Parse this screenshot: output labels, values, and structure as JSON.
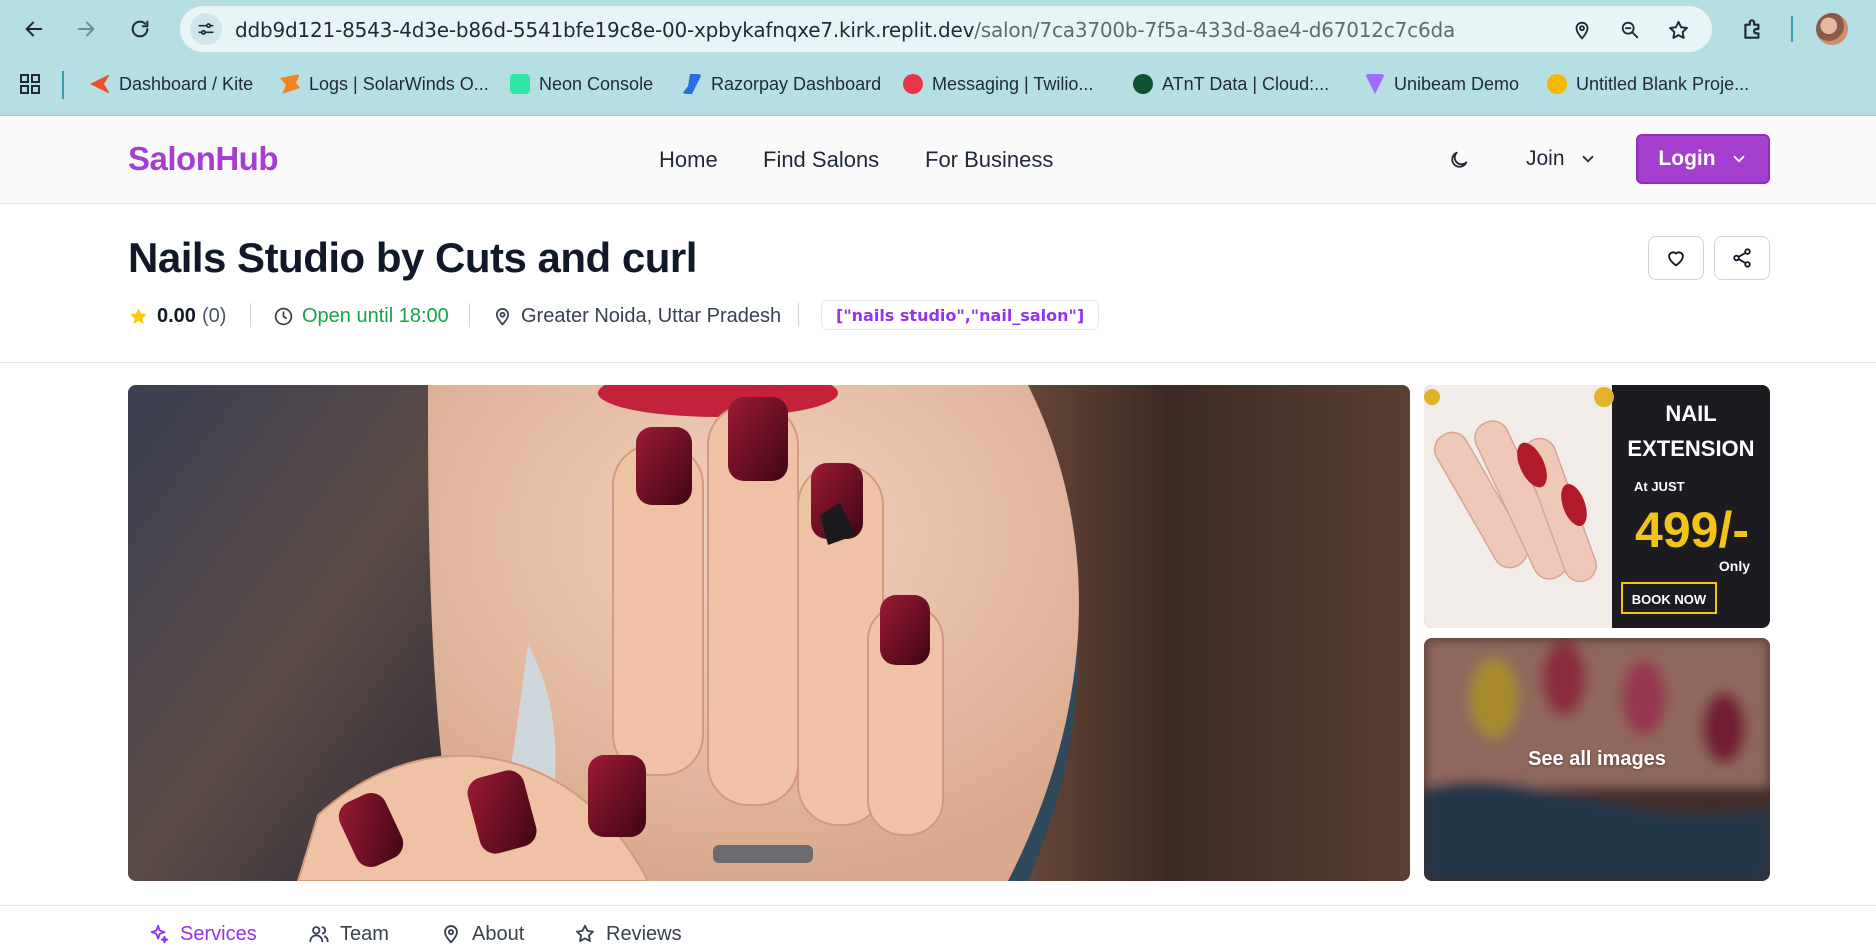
{
  "browser": {
    "url_host": "ddb9d121-8543-4d3e-b86d-5541bfe19c8e-00-xpbykafnqxe7.kirk.replit.dev",
    "url_path": "/salon/7ca3700b-7f5a-433d-8ae4-d67012c7c6da",
    "bookmarks": [
      {
        "label": "Dashboard / Kite",
        "icon": "kite-icon",
        "color": "#e9512b"
      },
      {
        "label": "Logs | SolarWinds O...",
        "icon": "solarwinds-icon",
        "color": "#f58220"
      },
      {
        "label": "Neon Console",
        "icon": "neon-icon",
        "color": "#2ee6a6"
      },
      {
        "label": "Razorpay Dashboard",
        "icon": "razorpay-icon",
        "color": "#2b6de8"
      },
      {
        "label": "Messaging | Twilio...",
        "icon": "twilio-icon",
        "color": "#e8354b"
      },
      {
        "label": "ATnT Data | Cloud:...",
        "icon": "mongodb-icon",
        "color": "#0f5132"
      },
      {
        "label": "Unibeam Demo",
        "icon": "vite-icon",
        "color": "#9c6cff"
      },
      {
        "label": "Untitled Blank Proje...",
        "icon": "bookmark-favicon-yellow",
        "color": "#f5b800"
      }
    ]
  },
  "header": {
    "brand": "SalonHub",
    "nav": [
      "Home",
      "Find Salons",
      "For Business"
    ],
    "join_label": "Join",
    "login_label": "Login"
  },
  "salon": {
    "name": "Nails Studio by Cuts and curl",
    "rating": "0.00",
    "review_count": "(0)",
    "open_status": "Open until 18:00",
    "location": "Greater Noida, Uttar Pradesh",
    "category_tag": "[\"nails studio\",\"nail_salon\"]"
  },
  "gallery": {
    "promo": {
      "title_line1": "NAIL",
      "title_line2": "EXTENSION",
      "subtitle": "At JUST",
      "price": "499/-",
      "price_suffix": "Only",
      "cta": "BOOK NOW"
    },
    "see_all_label": "See all images"
  },
  "tabs": [
    "Services",
    "Team",
    "About",
    "Reviews"
  ],
  "colors": {
    "brand": "#a43fd0",
    "tab_active": "#9333ea",
    "open_status": "#16a34a",
    "browser_chrome": "#b6dfe4"
  }
}
